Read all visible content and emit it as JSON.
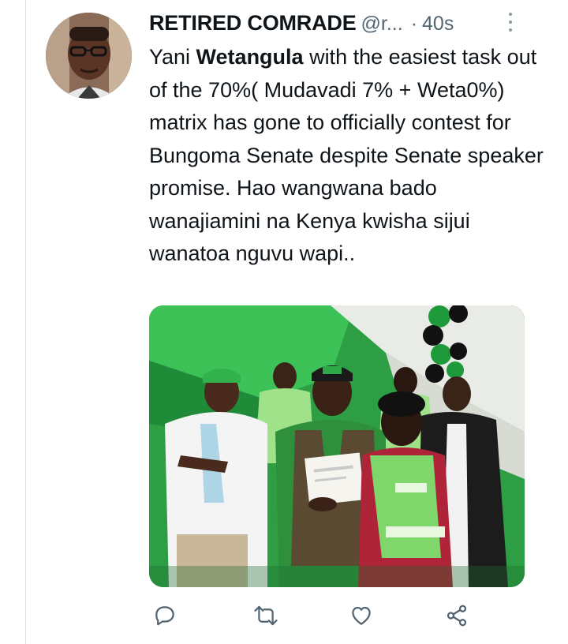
{
  "tweet": {
    "author_name": "RETIRED COMRADE",
    "author_handle": "@r...",
    "separator": "·",
    "time": "40s",
    "text_before": "Yani ",
    "text_bold": "Wetangula",
    "text_after": " with the easiest task out of the 70%( Mudavadi 7% + Weta0%) matrix has gone to officially contest for Bungoma Senate despite Senate speaker promise. Hao wangwana bado wanajiamini na Kenya kwisha sijui wanatoa nguvu wapi.."
  },
  "icons": {
    "more": "more-vertical-icon",
    "reply": "reply-icon",
    "retweet": "retweet-icon",
    "like": "heart-icon",
    "share": "share-icon"
  },
  "colors": {
    "text": "#0f1419",
    "muted": "#536471",
    "icon": "#536471",
    "party_green": "#2fa84a"
  }
}
